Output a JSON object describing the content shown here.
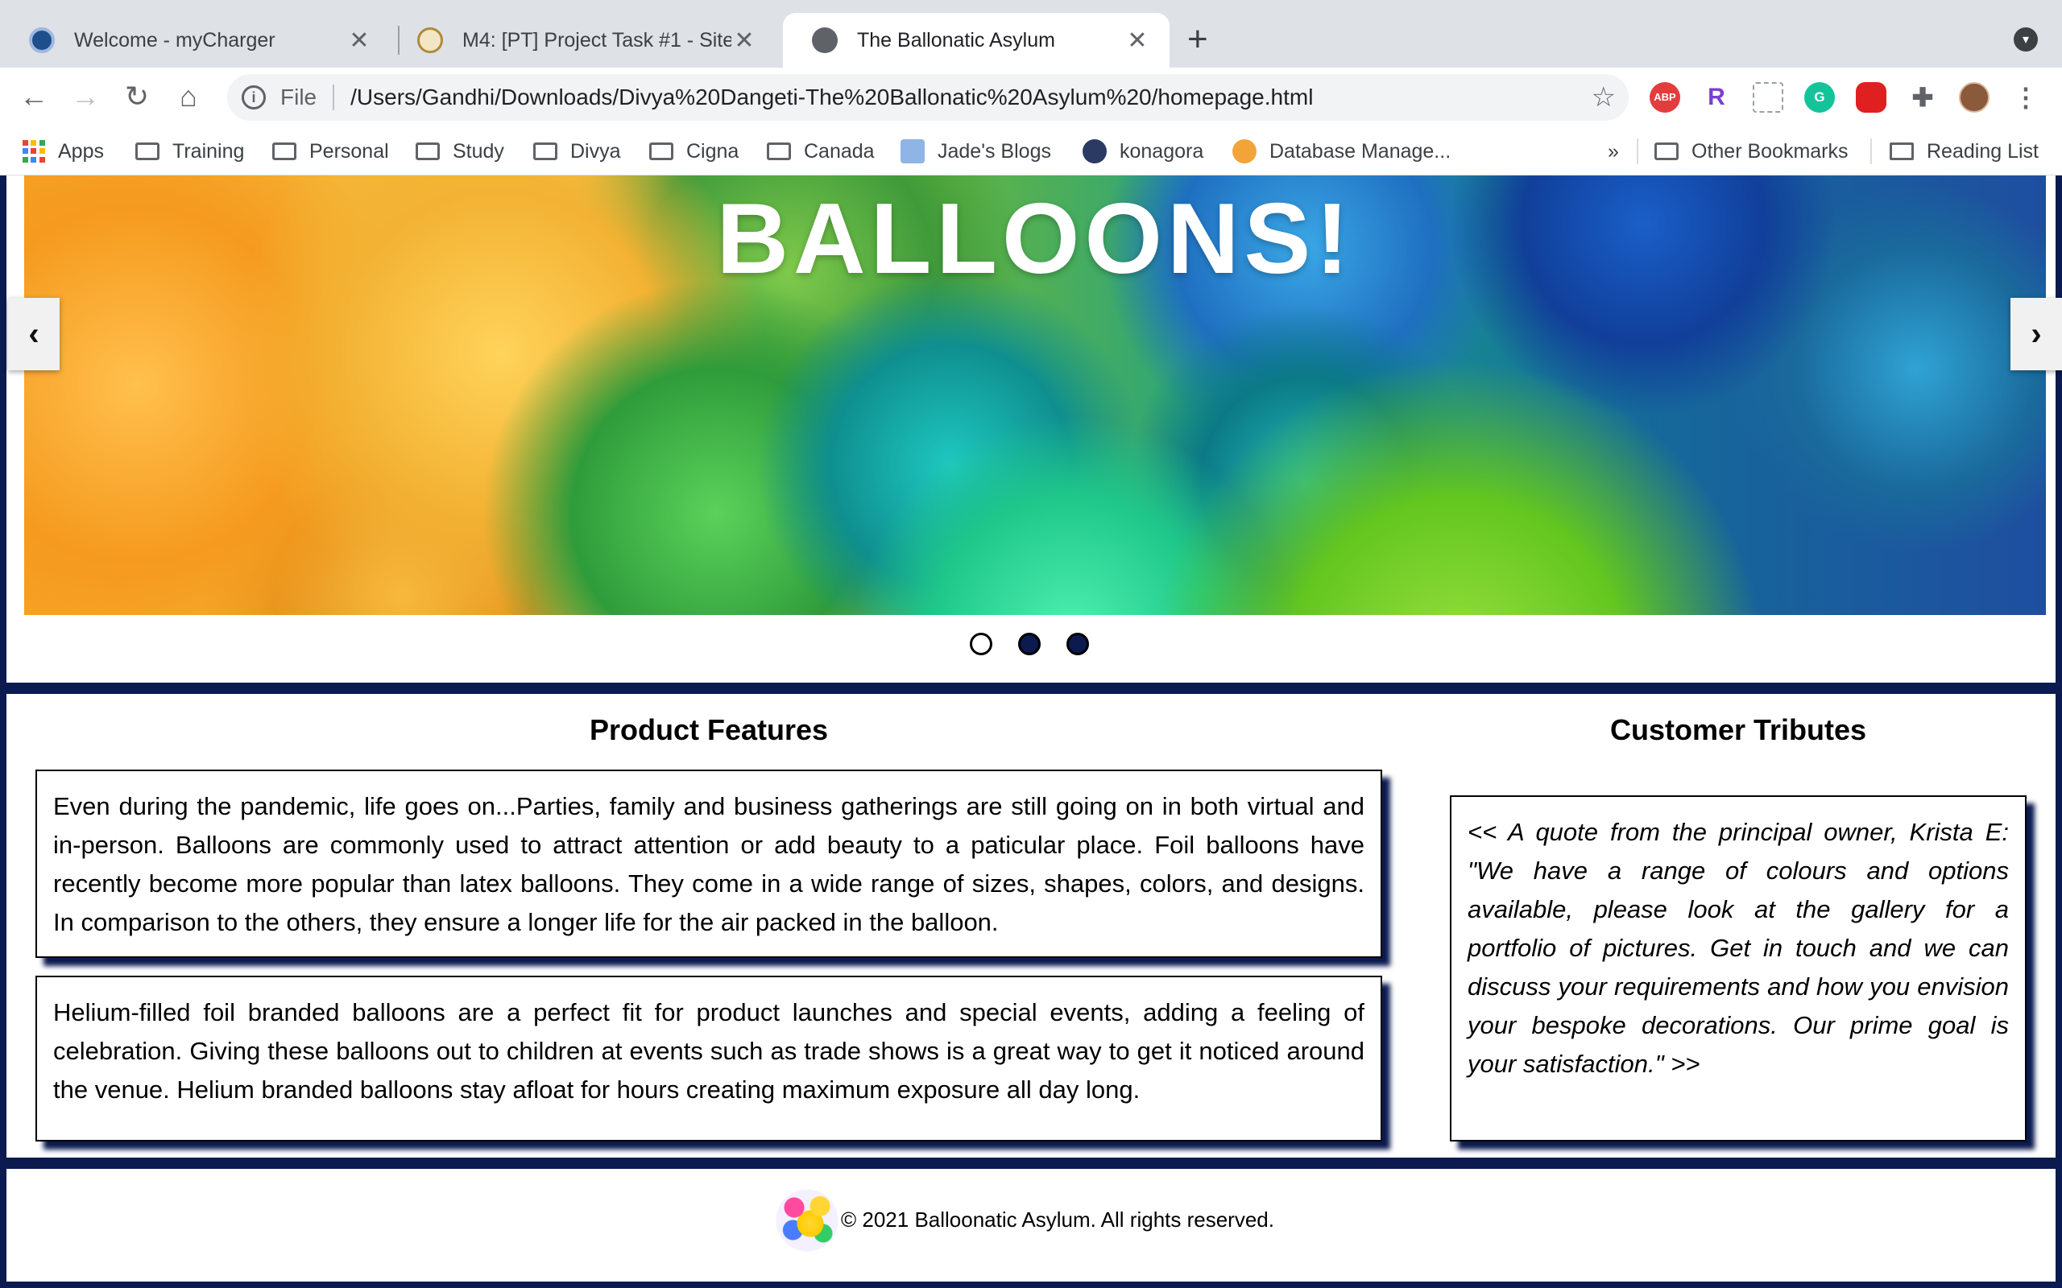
{
  "browser": {
    "tabs": [
      {
        "title": "Welcome - myCharger",
        "favicon": "mycharger-icon"
      },
      {
        "title": "M4: [PT] Project Task #1 - Site",
        "favicon": "course-icon"
      },
      {
        "title": "The Ballonatic Asylum",
        "favicon": "globe-icon",
        "active": true
      }
    ],
    "address": {
      "scheme_label": "File",
      "url": "/Users/Gandhi/Downloads/Divya%20Dangeti-The%20Ballonatic%20Asylum%20/homepage.html"
    },
    "extensions": [
      {
        "name": "adblock-plus-icon",
        "label": "ABP",
        "color": "#e33c3c"
      },
      {
        "name": "readwise-icon",
        "label": "R",
        "color": "#7a3fd1"
      },
      {
        "name": "screenshot-extension-icon",
        "label": "",
        "color": "#b0b4b8"
      },
      {
        "name": "grammarly-icon",
        "label": "G",
        "color": "#15c39a"
      },
      {
        "name": "stop-icon",
        "label": "",
        "color": "#e02020"
      }
    ],
    "bookmarks": [
      {
        "label": "Apps",
        "icon": "apps-icon"
      },
      {
        "label": "Training",
        "icon": "folder-icon"
      },
      {
        "label": "Personal",
        "icon": "folder-icon"
      },
      {
        "label": "Study",
        "icon": "folder-icon"
      },
      {
        "label": "Divya",
        "icon": "folder-icon"
      },
      {
        "label": "Cigna",
        "icon": "folder-icon"
      },
      {
        "label": "Canada",
        "icon": "folder-icon"
      },
      {
        "label": "Jade's Blogs",
        "icon": "blog-icon"
      },
      {
        "label": "konagora",
        "icon": "konagora-icon"
      },
      {
        "label": "Database Manage...",
        "icon": "database-icon"
      }
    ],
    "bookmarks_overflow": "»",
    "other_bookmarks": "Other Bookmarks",
    "reading_list": "Reading List"
  },
  "page": {
    "hero": {
      "title": "BALLOONS!",
      "prev_label": "‹",
      "next_label": "›",
      "slide_count": 3,
      "current_slide": 1
    },
    "features": {
      "heading": "Product Features",
      "paragraphs": [
        "Even during the pandemic, life goes on...Parties, family and business gatherings are still going on in both virtual and in-person. Balloons are commonly used to attract attention or add beauty to a paticular place. Foil balloons have recently become more popular than latex balloons. They come in a wide range of sizes, shapes, colors, and designs. In comparison to the others, they ensure a longer life for the air packed in the balloon.",
        "Helium-filled foil branded balloons are a perfect fit for product launches and special events, adding a feeling of celebration. Giving these balloons out to children at events such as trade shows is a great way to get it noticed around the venue. Helium branded balloons stay afloat for hours creating maximum exposure all day long."
      ]
    },
    "tributes": {
      "heading": "Customer Tributes",
      "quote": "<< A quote from the principal owner, Krista E: \"We have a range of colours and options available, please look at the gallery for a portfolio of pictures. Get in touch and we can discuss your requirements and how you envision your bespoke decorations. Our prime goal is your satisfaction.\" >>"
    },
    "footer": {
      "copyright": "© 2021 Balloonatic Asylum. All rights reserved."
    },
    "colors": {
      "accent_navy": "#0b1a4f",
      "text": "#000000"
    }
  }
}
